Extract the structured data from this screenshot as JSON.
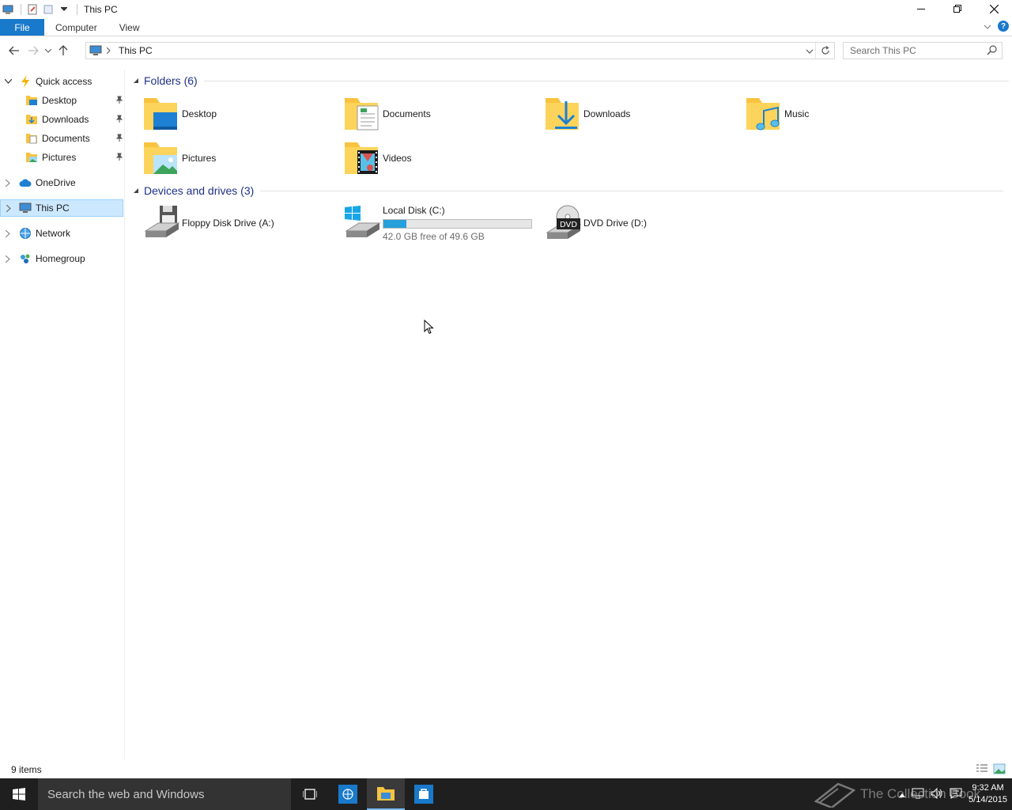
{
  "window": {
    "title": "This PC",
    "minimize_icon": "minimize-icon",
    "maximize_icon": "restore-icon",
    "close_icon": "close-icon"
  },
  "ribbon": {
    "file_label": "File",
    "tabs": [
      {
        "label": "Computer"
      },
      {
        "label": "View"
      }
    ],
    "help": "?"
  },
  "address": {
    "path": "This PC",
    "search_placeholder": "Search This PC"
  },
  "nav": {
    "quick_access": "Quick access",
    "pinned": [
      {
        "label": "Desktop"
      },
      {
        "label": "Downloads"
      },
      {
        "label": "Documents"
      },
      {
        "label": "Pictures"
      }
    ],
    "onedrive": "OneDrive",
    "this_pc": "This PC",
    "network": "Network",
    "homegroup": "Homegroup"
  },
  "content": {
    "folders_header": "Folders (6)",
    "folders": [
      {
        "label": "Desktop"
      },
      {
        "label": "Documents"
      },
      {
        "label": "Downloads"
      },
      {
        "label": "Music"
      },
      {
        "label": "Pictures"
      },
      {
        "label": "Videos"
      }
    ],
    "drives_header": "Devices and drives (3)",
    "drives": [
      {
        "label": "Floppy Disk Drive (A:)"
      },
      {
        "label": "Local Disk (C:)",
        "free_text": "42.0 GB free of 49.6 GB",
        "used_fraction": 0.153
      },
      {
        "label": "DVD Drive (D:)",
        "badge": "DVD"
      }
    ]
  },
  "status": {
    "items": "9 items"
  },
  "taskbar": {
    "search_placeholder": "Search the web and Windows",
    "watermark": "The Collection Book",
    "time": "9:32 AM",
    "date": "5/14/2015"
  },
  "colors": {
    "accent": "#1979ca",
    "selection": "#cce8ff",
    "group_header": "#1e3287",
    "folder_yellow": "#f8c33f",
    "drive_bar": "#26a0da"
  }
}
